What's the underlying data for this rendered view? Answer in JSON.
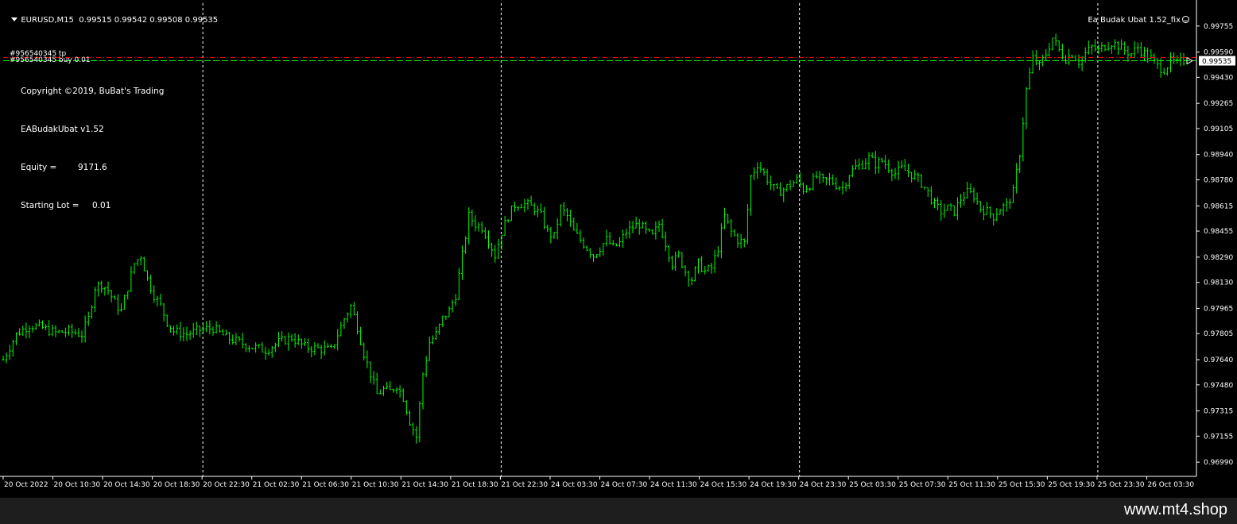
{
  "header": {
    "symbol": "EURUSD,M15",
    "ohlc": "0.99515 0.99542 0.99508 0.99535",
    "ea_name": "Ea Budak Ubat 1.52_fix"
  },
  "info_panel": {
    "copyright": "Copyright ©2019, BuBat's Trading",
    "ea_version": "EABudakUbat v1.52",
    "equity_label": "Equity =",
    "equity_value": "9171.6",
    "lot_label": "Starting Lot =",
    "lot_value": "0.01"
  },
  "orders": {
    "tp_label": "#956540345 tp",
    "buy_label": "#956540345 buy 0.01"
  },
  "colors": {
    "background": "#000000",
    "candle": "#00ff00",
    "grid": "#ffffff",
    "tp_line": "#ff0000",
    "buy_line": "#00ff00",
    "text": "#ffffff"
  },
  "footer": {
    "watermark": "www.mt4.shop"
  },
  "chart_data": {
    "type": "line",
    "symbol": "EURUSD",
    "timeframe": "M15",
    "current_price": 0.99535,
    "current_price_label": "0.99535",
    "tp_level": 0.99555,
    "buy_level": 0.99535,
    "ylim": [
      0.969,
      0.999
    ],
    "y_ticks": [
      "0.99755",
      "0.99590",
      "0.99430",
      "0.99265",
      "0.99105",
      "0.98940",
      "0.98780",
      "0.98615",
      "0.98455",
      "0.98290",
      "0.98130",
      "0.97965",
      "0.97805",
      "0.97640",
      "0.97480",
      "0.97315",
      "0.97155",
      "0.96990"
    ],
    "x_ticks": [
      "20 Oct 2022",
      "20 Oct 10:30",
      "20 Oct 14:30",
      "20 Oct 18:30",
      "20 Oct 22:30",
      "21 Oct 02:30",
      "21 Oct 06:30",
      "21 Oct 10:30",
      "21 Oct 14:30",
      "21 Oct 18:30",
      "21 Oct 22:30",
      "24 Oct 03:30",
      "24 Oct 07:30",
      "24 Oct 11:30",
      "24 Oct 15:30",
      "24 Oct 19:30",
      "24 Oct 23:30",
      "25 Oct 03:30",
      "25 Oct 07:30",
      "25 Oct 11:30",
      "25 Oct 15:30",
      "25 Oct 19:30",
      "25 Oct 23:30",
      "26 Oct 03:30"
    ],
    "day_separators": [
      "20 Oct 22:30",
      "21 Oct 22:30",
      "24 Oct 23:30",
      "25 Oct 23:30"
    ],
    "price_path": [
      [
        0,
        0.9764
      ],
      [
        4,
        0.978
      ],
      [
        8,
        0.9786
      ],
      [
        12,
        0.9784
      ],
      [
        16,
        0.9781
      ],
      [
        20,
        0.9782
      ],
      [
        24,
        0.978
      ],
      [
        26,
        0.979
      ],
      [
        28,
        0.981
      ],
      [
        30,
        0.9812
      ],
      [
        32,
        0.9808
      ],
      [
        34,
        0.98
      ],
      [
        36,
        0.9795
      ],
      [
        38,
        0.981
      ],
      [
        40,
        0.9825
      ],
      [
        42,
        0.983
      ],
      [
        44,
        0.9815
      ],
      [
        46,
        0.9805
      ],
      [
        48,
        0.9798
      ],
      [
        50,
        0.9788
      ],
      [
        52,
        0.9782
      ],
      [
        56,
        0.978
      ],
      [
        60,
        0.9783
      ],
      [
        64,
        0.9784
      ],
      [
        68,
        0.9778
      ],
      [
        72,
        0.9775
      ],
      [
        76,
        0.9772
      ],
      [
        80,
        0.977
      ],
      [
        84,
        0.9775
      ],
      [
        88,
        0.9778
      ],
      [
        92,
        0.9772
      ],
      [
        96,
        0.9771
      ],
      [
        100,
        0.977
      ],
      [
        104,
        0.979
      ],
      [
        106,
        0.9798
      ],
      [
        108,
        0.9785
      ],
      [
        110,
        0.9768
      ],
      [
        112,
        0.9755
      ],
      [
        114,
        0.9742
      ],
      [
        116,
        0.9745
      ],
      [
        118,
        0.9744
      ],
      [
        120,
        0.9748
      ],
      [
        122,
        0.974
      ],
      [
        124,
        0.9725
      ],
      [
        126,
        0.9715
      ],
      [
        128,
        0.9755
      ],
      [
        130,
        0.9775
      ],
      [
        132,
        0.978
      ],
      [
        134,
        0.979
      ],
      [
        136,
        0.9795
      ],
      [
        138,
        0.9805
      ],
      [
        140,
        0.983
      ],
      [
        142,
        0.9855
      ],
      [
        144,
        0.985
      ],
      [
        146,
        0.9848
      ],
      [
        148,
        0.984
      ],
      [
        150,
        0.983
      ],
      [
        152,
        0.9845
      ],
      [
        154,
        0.9855
      ],
      [
        156,
        0.9862
      ],
      [
        158,
        0.9863
      ],
      [
        160,
        0.9862
      ],
      [
        162,
        0.986
      ],
      [
        164,
        0.9855
      ],
      [
        166,
        0.9845
      ],
      [
        168,
        0.9842
      ],
      [
        170,
        0.986
      ],
      [
        172,
        0.9855
      ],
      [
        174,
        0.9845
      ],
      [
        176,
        0.984
      ],
      [
        178,
        0.9835
      ],
      [
        180,
        0.983
      ],
      [
        182,
        0.9835
      ],
      [
        184,
        0.984
      ],
      [
        186,
        0.9835
      ],
      [
        188,
        0.9838
      ],
      [
        190,
        0.9845
      ],
      [
        192,
        0.9848
      ],
      [
        194,
        0.985
      ],
      [
        196,
        0.9845
      ],
      [
        198,
        0.9842
      ],
      [
        200,
        0.985
      ],
      [
        202,
        0.9838
      ],
      [
        204,
        0.9825
      ],
      [
        206,
        0.983
      ],
      [
        208,
        0.982
      ],
      [
        210,
        0.9815
      ],
      [
        212,
        0.9825
      ],
      [
        214,
        0.982
      ],
      [
        216,
        0.9822
      ],
      [
        218,
        0.9835
      ],
      [
        220,
        0.9855
      ],
      [
        222,
        0.9845
      ],
      [
        224,
        0.984
      ],
      [
        226,
        0.9838
      ],
      [
        228,
        0.988
      ],
      [
        230,
        0.9888
      ],
      [
        232,
        0.9882
      ],
      [
        234,
        0.9875
      ],
      [
        236,
        0.987
      ],
      [
        238,
        0.9872
      ],
      [
        240,
        0.9875
      ],
      [
        242,
        0.9878
      ],
      [
        244,
        0.9872
      ],
      [
        246,
        0.9875
      ],
      [
        248,
        0.988
      ],
      [
        250,
        0.9877
      ],
      [
        252,
        0.9878
      ],
      [
        254,
        0.9875
      ],
      [
        256,
        0.9873
      ],
      [
        258,
        0.9882
      ],
      [
        260,
        0.9886
      ],
      [
        262,
        0.9888
      ],
      [
        264,
        0.9892
      ],
      [
        266,
        0.9888
      ],
      [
        268,
        0.989
      ],
      [
        270,
        0.9886
      ],
      [
        272,
        0.9882
      ],
      [
        274,
        0.9885
      ],
      [
        276,
        0.9883
      ],
      [
        278,
        0.988
      ],
      [
        280,
        0.9876
      ],
      [
        282,
        0.987
      ],
      [
        284,
        0.9862
      ],
      [
        286,
        0.9858
      ],
      [
        288,
        0.986
      ],
      [
        290,
        0.9858
      ],
      [
        292,
        0.9866
      ],
      [
        294,
        0.987
      ],
      [
        296,
        0.9868
      ],
      [
        298,
        0.986
      ],
      [
        300,
        0.9858
      ],
      [
        302,
        0.9855
      ],
      [
        304,
        0.986
      ],
      [
        306,
        0.9862
      ],
      [
        308,
        0.987
      ],
      [
        310,
        0.9895
      ],
      [
        312,
        0.9935
      ],
      [
        314,
        0.9955
      ],
      [
        316,
        0.995
      ],
      [
        318,
        0.9958
      ],
      [
        320,
        0.9968
      ],
      [
        322,
        0.996
      ],
      [
        324,
        0.9955
      ],
      [
        326,
        0.9958
      ],
      [
        328,
        0.9953
      ],
      [
        330,
        0.9958
      ],
      [
        332,
        0.9962
      ],
      [
        334,
        0.996
      ],
      [
        336,
        0.9963
      ],
      [
        338,
        0.9965
      ],
      [
        340,
        0.9963
      ],
      [
        342,
        0.996
      ],
      [
        344,
        0.9958
      ],
      [
        346,
        0.9962
      ],
      [
        348,
        0.9958
      ],
      [
        350,
        0.9955
      ],
      [
        352,
        0.995
      ],
      [
        354,
        0.9948
      ],
      [
        356,
        0.9953
      ],
      [
        358,
        0.9952
      ],
      [
        360,
        0.99535
      ]
    ]
  }
}
